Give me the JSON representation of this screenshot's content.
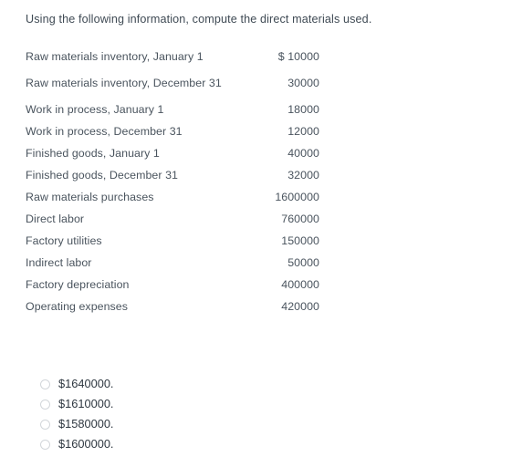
{
  "question": {
    "prompt": "Using the following information, compute the direct materials used.",
    "table": {
      "rows": [
        {
          "label": "Raw materials inventory, January 1",
          "value": "$ 10000",
          "wraps": false
        },
        {
          "label": "Raw materials inventory, December 31",
          "value": "30000",
          "wraps": true
        },
        {
          "label": "Work in process, January 1",
          "value": "18000",
          "wraps": false
        },
        {
          "label": "Work in process, December 31",
          "value": "12000",
          "wraps": false
        },
        {
          "label": "Finished goods, January 1",
          "value": "40000",
          "wraps": false
        },
        {
          "label": "Finished goods, December 31",
          "value": "32000",
          "wraps": false
        },
        {
          "label": "Raw materials purchases",
          "value": "1600000",
          "wraps": false
        },
        {
          "label": "Direct labor",
          "value": "760000",
          "wraps": false
        },
        {
          "label": "Factory utilities",
          "value": "150000",
          "wraps": false
        },
        {
          "label": "Indirect labor",
          "value": "50000",
          "wraps": false
        },
        {
          "label": "Factory depreciation",
          "value": "400000",
          "wraps": false
        },
        {
          "label": "Operating expenses",
          "value": "420000",
          "wraps": false
        }
      ]
    },
    "options": [
      {
        "label": "$1640000.",
        "selected": false
      },
      {
        "label": "$1610000.",
        "selected": false
      },
      {
        "label": "$1580000.",
        "selected": false
      },
      {
        "label": "$1600000.",
        "selected": false
      }
    ]
  },
  "colors": {
    "background": "#ffffff",
    "prompt_text": "#3f4a54",
    "table_text": "#4a545e",
    "option_text": "#2e3740",
    "radio_border": "#d2d6da"
  }
}
